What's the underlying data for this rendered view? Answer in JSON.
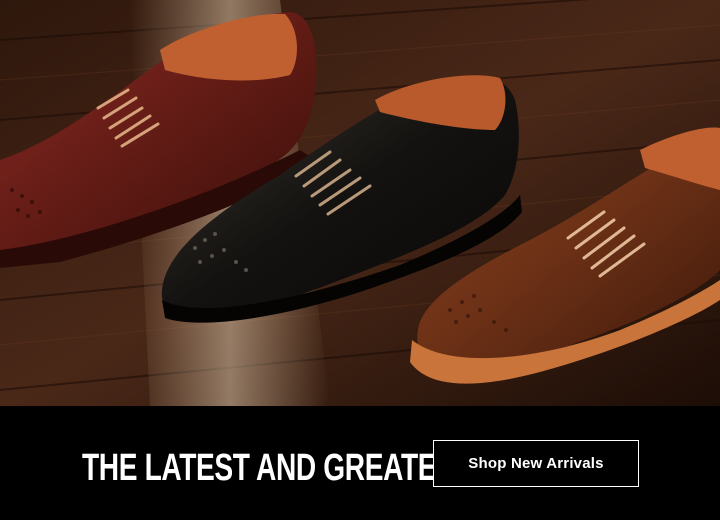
{
  "hero": {
    "image_subject": "three-brogue-oxford-dress-shoes-on-wood-floor",
    "colors": {
      "floor_dark": "#2a140b",
      "floor_mid": "#4a2818",
      "burgundy_shoe": "#5e1a14",
      "black_shoe": "#141210",
      "brown_shoe": "#6b3016",
      "sole_tan": "#c8743a",
      "lining": "#c06030"
    }
  },
  "cta": {
    "headline": "THE LATEST AND GREATEST",
    "button_label": "Shop New Arrivals",
    "background": "#000000",
    "text_color": "#ffffff"
  }
}
